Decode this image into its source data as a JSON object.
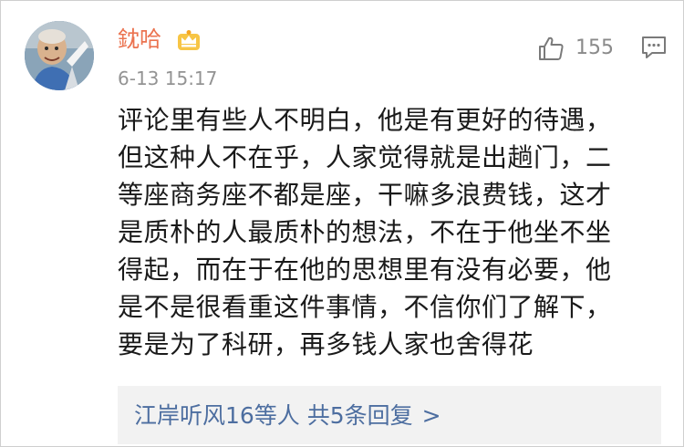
{
  "comment": {
    "username": "鈂哈",
    "timestamp": "6-13 15:17",
    "likes": "155",
    "lines": [
      "评论里有些人不明白，他是有更好的待遇，",
      "但这种人不在乎，人家觉得就是出趟门，二",
      "等座商务座不都是座，干嘛多浪费钱，这才",
      "是质朴的人最质朴的想法，不在于他坐不坐",
      "得起，而在于在他的思想里有没有必要，他",
      "是不是很看重这件事情，不信你们了解下，",
      "要是为了科研，再多钱人家也舍得花"
    ],
    "replies_summary": "江岸听风16等人  共5条回复",
    "replies_chevron": ">"
  },
  "icons": {
    "avatar": "avatar",
    "badge": "crown-badge-icon",
    "like": "thumbs-up-icon",
    "comment": "comment-bubble-icon"
  },
  "colors": {
    "username": "#eb7350",
    "timestamp": "#939393",
    "body": "#1a1a1a",
    "reply_link": "#4d6ea0",
    "reply_bg": "#f2f2f2",
    "crown": "#f5a623"
  }
}
